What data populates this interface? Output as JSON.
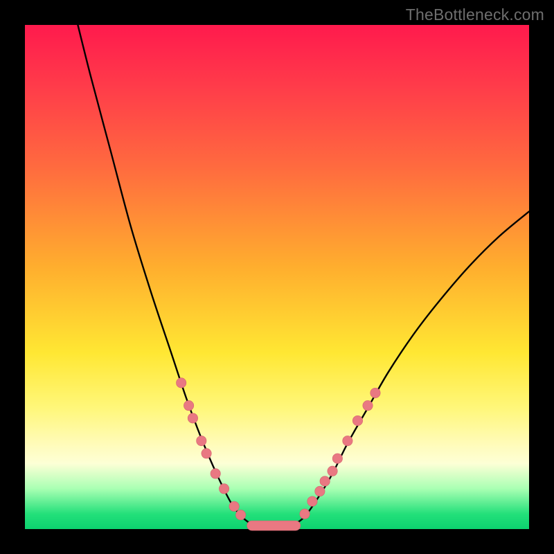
{
  "watermark": "TheBottleneck.com",
  "colors": {
    "frame": "#000000",
    "curve": "#000000",
    "marker_fill": "#e97882",
    "marker_stroke": "#d2636e"
  },
  "chart_data": {
    "type": "line",
    "title": "",
    "xlabel": "",
    "ylabel": "",
    "xlim": [
      0,
      100
    ],
    "ylim": [
      0,
      100
    ],
    "grid": false,
    "legend": false,
    "annotations": [],
    "curve_points": [
      {
        "x": 10,
        "y": 102
      },
      {
        "x": 13,
        "y": 90
      },
      {
        "x": 17,
        "y": 75
      },
      {
        "x": 21,
        "y": 60
      },
      {
        "x": 25,
        "y": 47
      },
      {
        "x": 29,
        "y": 35
      },
      {
        "x": 32,
        "y": 26
      },
      {
        "x": 35,
        "y": 18
      },
      {
        "x": 38,
        "y": 11
      },
      {
        "x": 41,
        "y": 5
      },
      {
        "x": 43.5,
        "y": 2
      },
      {
        "x": 46,
        "y": 0.6
      },
      {
        "x": 49,
        "y": 0.5
      },
      {
        "x": 52,
        "y": 0.6
      },
      {
        "x": 55,
        "y": 2
      },
      {
        "x": 58,
        "y": 6
      },
      {
        "x": 61,
        "y": 11
      },
      {
        "x": 64,
        "y": 17
      },
      {
        "x": 68,
        "y": 24
      },
      {
        "x": 72,
        "y": 31
      },
      {
        "x": 77,
        "y": 38.5
      },
      {
        "x": 82,
        "y": 45
      },
      {
        "x": 88,
        "y": 52
      },
      {
        "x": 94,
        "y": 58
      },
      {
        "x": 100,
        "y": 63
      }
    ],
    "markers_left": [
      {
        "x": 31.0,
        "y": 29.0
      },
      {
        "x": 32.5,
        "y": 24.5
      },
      {
        "x": 33.3,
        "y": 22.0
      },
      {
        "x": 35.0,
        "y": 17.5
      },
      {
        "x": 36.0,
        "y": 15.0
      },
      {
        "x": 37.8,
        "y": 11.0
      },
      {
        "x": 39.5,
        "y": 8.0
      },
      {
        "x": 41.5,
        "y": 4.5
      },
      {
        "x": 42.8,
        "y": 2.8
      }
    ],
    "markers_right": [
      {
        "x": 55.5,
        "y": 3.0
      },
      {
        "x": 57.0,
        "y": 5.5
      },
      {
        "x": 58.5,
        "y": 7.5
      },
      {
        "x": 59.5,
        "y": 9.5
      },
      {
        "x": 61.0,
        "y": 11.5
      },
      {
        "x": 62.0,
        "y": 14.0
      },
      {
        "x": 64.0,
        "y": 17.5
      },
      {
        "x": 66.0,
        "y": 21.5
      },
      {
        "x": 68.0,
        "y": 24.5
      },
      {
        "x": 69.5,
        "y": 27.0
      }
    ],
    "markers_bottom": [
      {
        "x": 45.0,
        "y": 0.9
      },
      {
        "x": 46.8,
        "y": 0.6
      },
      {
        "x": 48.5,
        "y": 0.5
      },
      {
        "x": 50.2,
        "y": 0.5
      },
      {
        "x": 52.0,
        "y": 0.6
      },
      {
        "x": 53.7,
        "y": 1.0
      }
    ]
  }
}
